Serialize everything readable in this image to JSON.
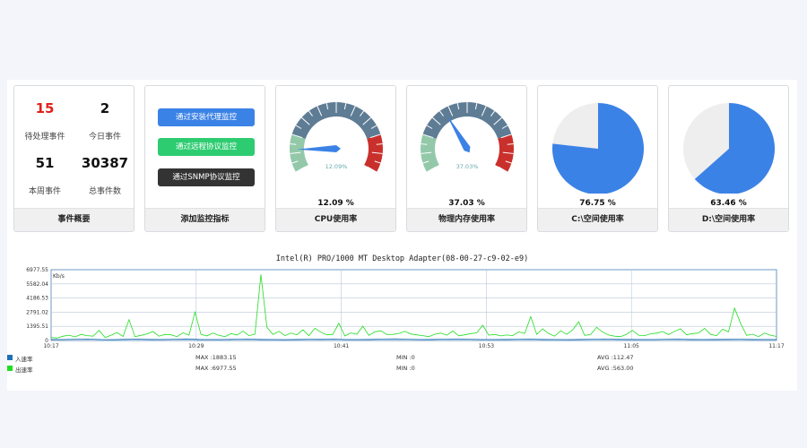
{
  "colors": {
    "accent_red": "#e0201c",
    "btn_agent": "#3b82e6",
    "btn_remote": "#2ecc71",
    "btn_snmp": "#333333",
    "pie_used": "#3b82e6",
    "pie_free": "#eeeeee",
    "series_in": "#1f6fb5",
    "series_out": "#22dd22"
  },
  "events": {
    "pending_count": "15",
    "pending_label": "待处理事件",
    "today_count": "2",
    "today_label": "今日事件",
    "week_count": "51",
    "week_label": "本周事件",
    "total_count": "30387",
    "total_label": "总事件数",
    "footer": "事件概要"
  },
  "monitor": {
    "btn_agent": "通过安装代理监控",
    "btn_remote": "通过远程协议监控",
    "btn_snmp": "通过SNMP协议监控",
    "footer": "添加监控指标"
  },
  "cpu": {
    "value": 12.09,
    "needle_text": "12.09%",
    "pct_text": "12.09 %",
    "footer": "CPU使用率"
  },
  "mem": {
    "value": 37.03,
    "needle_text": "37.03%",
    "pct_text": "37.03 %",
    "footer": "物理内存使用率"
  },
  "disk_c": {
    "value": 76.75,
    "pct_text": "76.75 %",
    "footer": "C:\\空间使用率"
  },
  "disk_d": {
    "value": 63.46,
    "pct_text": "63.46 %",
    "footer": "D:\\空间使用率"
  },
  "chart_data": {
    "type": "line",
    "title": "Intel(R) PRO/1000 MT Desktop Adapter(08-00-27-c9-02-e9)",
    "unit_label": "Kb/s",
    "ylim": [
      0,
      6977.55
    ],
    "y_ticks": [
      "6977.55",
      "5582.04",
      "4186.53",
      "2791.02",
      "1395.51",
      "0"
    ],
    "x_ticks": [
      "10:17",
      "10:29",
      "10:41",
      "10:53",
      "11:05",
      "11:17"
    ],
    "grid": true,
    "series": [
      {
        "name": "入速率",
        "color": "#1f6fb5",
        "values": [
          110,
          95,
          120,
          140,
          100,
          90,
          115,
          130,
          105,
          100,
          120,
          150,
          110,
          95,
          100,
          125,
          140,
          110,
          100,
          90,
          105,
          120,
          115,
          130,
          100,
          95,
          110,
          140,
          160,
          120,
          100,
          110,
          130,
          150,
          120,
          100,
          95,
          105,
          125,
          135,
          110,
          100,
          90,
          110,
          120,
          140,
          115,
          105,
          100,
          95,
          120,
          130,
          110,
          100,
          105,
          115,
          125,
          110,
          100,
          95
        ]
      },
      {
        "name": "出速率",
        "color": "#22dd22",
        "values": [
          300,
          250,
          420,
          520,
          350,
          600,
          480,
          420,
          1000,
          300,
          520,
          780,
          400,
          2050,
          380,
          500,
          650,
          880,
          420,
          600,
          560,
          380,
          760,
          520,
          2800,
          600,
          450,
          720,
          500,
          380,
          680,
          540,
          920,
          480,
          620,
          6500,
          1300,
          600,
          900,
          480,
          720,
          560,
          1050,
          480,
          1200,
          820,
          560,
          600,
          1700,
          450,
          750,
          620,
          1400,
          500,
          860,
          950,
          580,
          600,
          700,
          900,
          640,
          560,
          480,
          380,
          620,
          720,
          520,
          940,
          460,
          560,
          680,
          750,
          1500,
          520,
          600,
          450,
          540,
          480,
          850,
          700,
          2350,
          600,
          1150,
          680,
          420,
          950,
          600,
          1050,
          1850,
          500,
          580,
          1300,
          820,
          540,
          420,
          380,
          620,
          1000,
          520,
          480,
          650,
          720,
          880,
          580,
          900,
          1150,
          560,
          680,
          740,
          1200,
          600,
          480,
          1100,
          860,
          3200,
          1700,
          500,
          620,
          380,
          720,
          520,
          400
        ]
      }
    ],
    "legend": [
      {
        "name": "入速率",
        "max": "MAX :1883.15",
        "min": "MIN :0",
        "avg": "AVG :112.47"
      },
      {
        "name": "出速率",
        "max": "MAX :6977.55",
        "min": "MIN :0",
        "avg": "AVG :563.00"
      }
    ]
  }
}
